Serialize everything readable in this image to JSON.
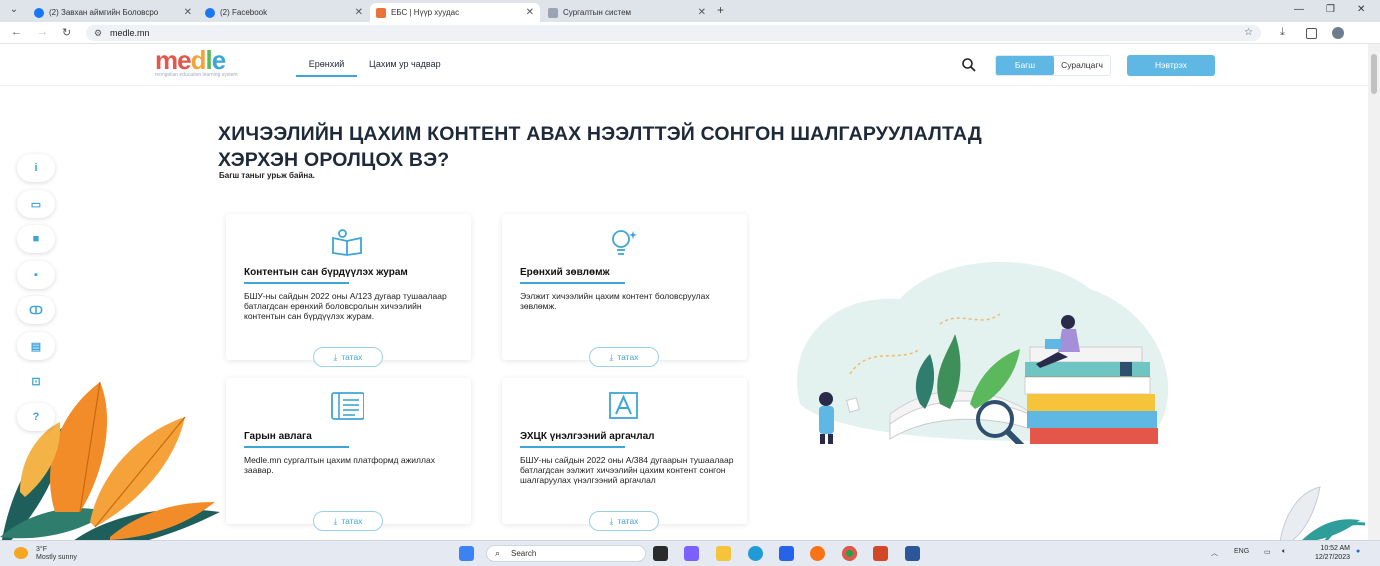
{
  "browser": {
    "tabs": [
      {
        "title": "(2) Завхан аймгийн Боловсро",
        "active": false,
        "favicon_color": "#1877f2"
      },
      {
        "title": "(2) Facebook",
        "active": false,
        "favicon_color": "#1877f2"
      },
      {
        "title": "ЕБС | Нүүр хуудас",
        "active": true,
        "favicon_color": "#e8743b"
      },
      {
        "title": "Сургалтын систем",
        "active": false,
        "favicon_color": "#9aa4b2"
      }
    ],
    "url": "medle.mn"
  },
  "site": {
    "logo": {
      "word": "medle",
      "tagline": "mongolian education learning system"
    },
    "nav": [
      "Ерөнхий",
      "Цахим ур чадвар"
    ],
    "role_toggle": {
      "selected": "Багш",
      "other": "Суралцагч"
    },
    "login_label": "Нэвтрэх",
    "accent_color": "#3ea5d6"
  },
  "main": {
    "heading_line1": "ХИЧЭЭЛИЙН ЦАХИМ КОНТЕНТ АВАХ НЭЭЛТТЭЙ СОНГОН ШАЛГАРУУЛАЛТАД",
    "heading_line2": "ХЭРХЭН ОРОЛЦОХ ВЭ?",
    "subtitle": "Багш таныг урьж байна.",
    "download_label": "татах",
    "cards": [
      {
        "icon": "open-book-icon",
        "title": "Контентын сан бүрдүүлэх журам",
        "description": "БШУ-ны сайдын 2022 оны А/123 дугаар тушаалаар батлагдсан ерөнхий боловсролын хичээлийн контентын сан бүрдүүлэх журам."
      },
      {
        "icon": "lightbulb-icon",
        "title": "Ерөнхий зөвлөмж",
        "description": "Ээлжит хичээлийн цахим контент боловсруулах зөвлөмж."
      },
      {
        "icon": "document-icon",
        "title": "Гарын авлага",
        "description": "Medle.mn сургалтын цахим платформд ажиллах заавар."
      },
      {
        "icon": "letter-a-icon",
        "title": "ЭХЦК үнэлгээний аргачлал",
        "description": "БШУ-ны сайдын 2022 оны А/384 дугаарын тушаалаар батлагдсан ээлжит хичээлийн цахим контент сонгон шалгаруулах үнэлгээний аргачлал"
      }
    ],
    "side_buttons": [
      "info-icon",
      "monitor-icon",
      "video-icon",
      "chat-icon",
      "robot-icon",
      "book-icon",
      "teacher-icon",
      "question-icon"
    ]
  },
  "taskbar": {
    "weather_temp": "3°F",
    "weather_text": "Mostly sunny",
    "search_placeholder": "Search",
    "lang": "ENG",
    "time": "10:52 AM",
    "date": "12/27/2023"
  }
}
